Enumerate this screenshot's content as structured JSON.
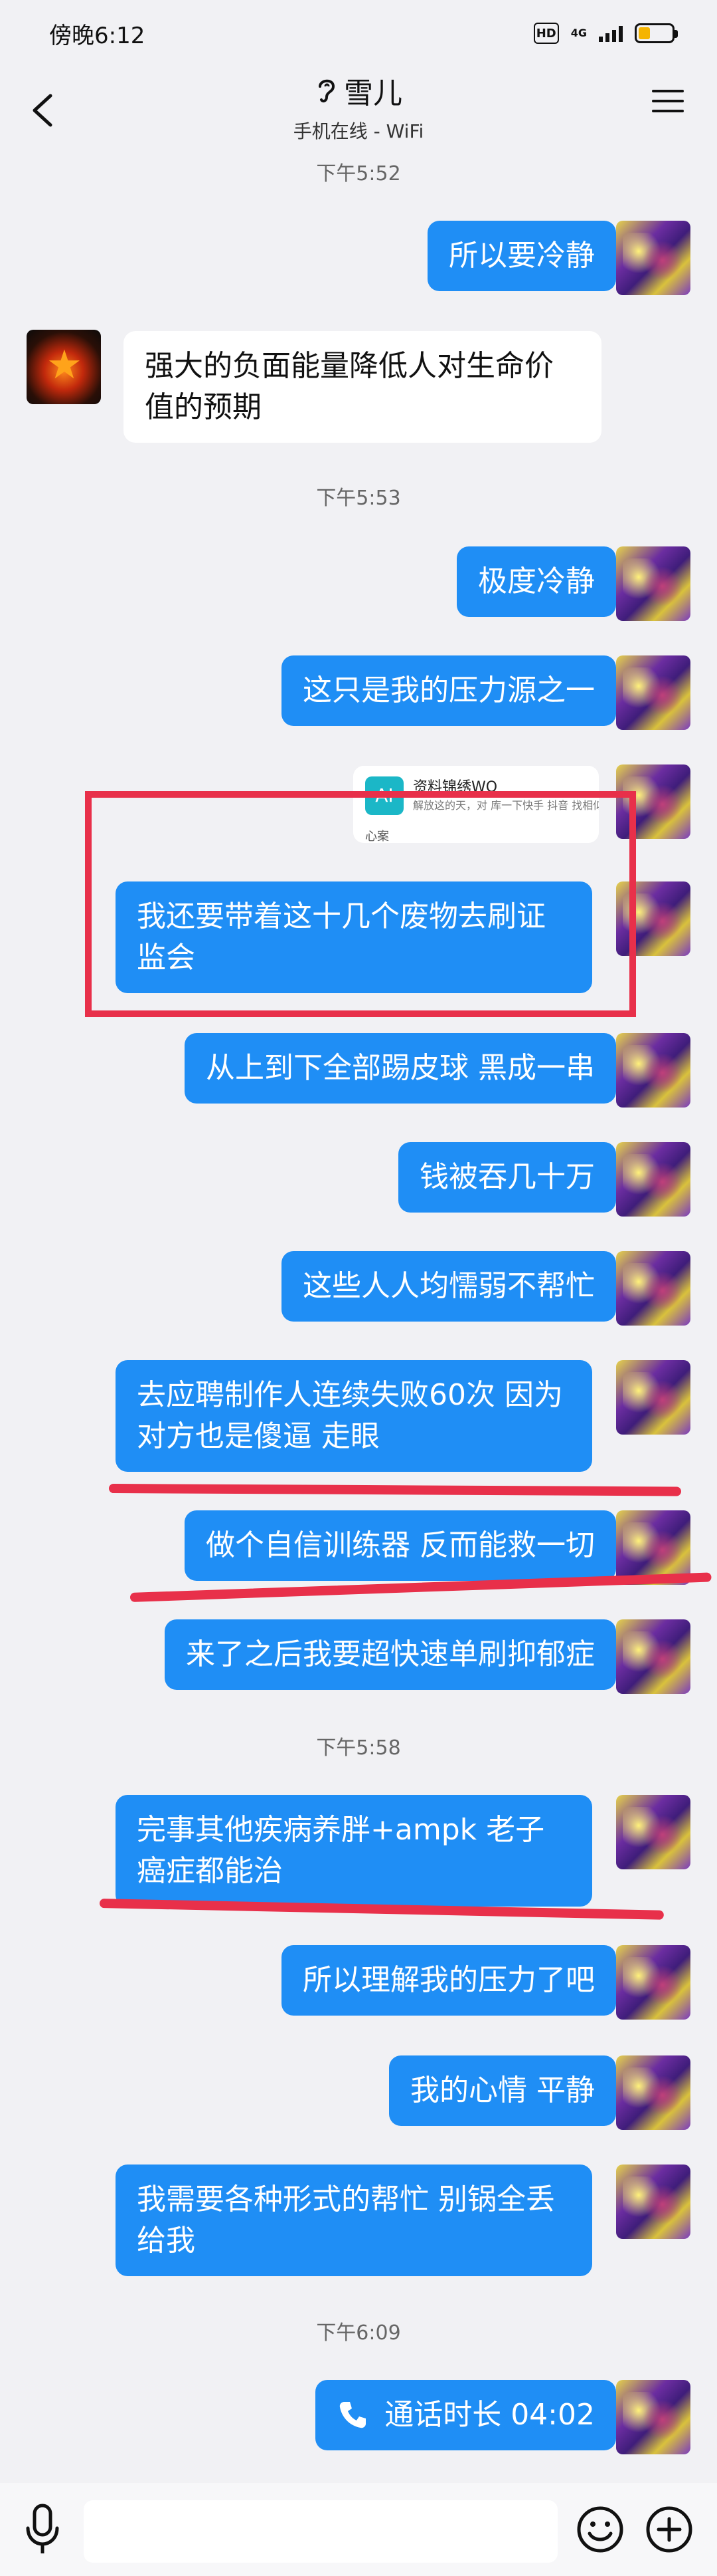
{
  "status_bar": {
    "time": "傍晚6:12",
    "hd": "HD",
    "network": "4G"
  },
  "header": {
    "title": "雪儿",
    "subtitle": "手机在线 - WiFi"
  },
  "messages": [
    {
      "text": "所以要冷静"
    },
    {
      "text": "强大的负面能量降低人对生命价值的预期"
    },
    {
      "text": "极度冷静"
    },
    {
      "text": "这只是我的压力源之一"
    },
    {
      "text": "我还要带着这十几个废物去刷证监会"
    },
    {
      "text": "从上到下全部踢皮球 黑成一串"
    },
    {
      "text": "钱被吞几十万"
    },
    {
      "text": "这些人人均懦弱不帮忙"
    },
    {
      "text": "去应聘制作人连续失败60次 因为对方也是傻逼 走眼"
    },
    {
      "text": "做个自信训练器 反而能救一切"
    },
    {
      "text": "来了之后我要超快速单刷抑郁症"
    },
    {
      "text": "完事其他疾病养胖+ampk 老子癌症都能治"
    },
    {
      "text": "所以理解我的压力了吧"
    },
    {
      "text": "我的心情 平静"
    },
    {
      "text": "我需要各种形式的帮忙 别锅全丢给我"
    },
    {
      "text": "通话时长 04:02"
    }
  ],
  "timestamps": [
    "下午5:52",
    "下午5:53",
    "下午5:58",
    "下午6:09"
  ],
  "card": {
    "title": "资料锦绣WO",
    "desc": "解放这的天，对 库一下快手 抖音 找相似",
    "sub": "心案"
  },
  "colors": {
    "my_bubble": "#1f8ef5",
    "their_bubble": "#ffffff",
    "annotation": "#e8304a"
  }
}
